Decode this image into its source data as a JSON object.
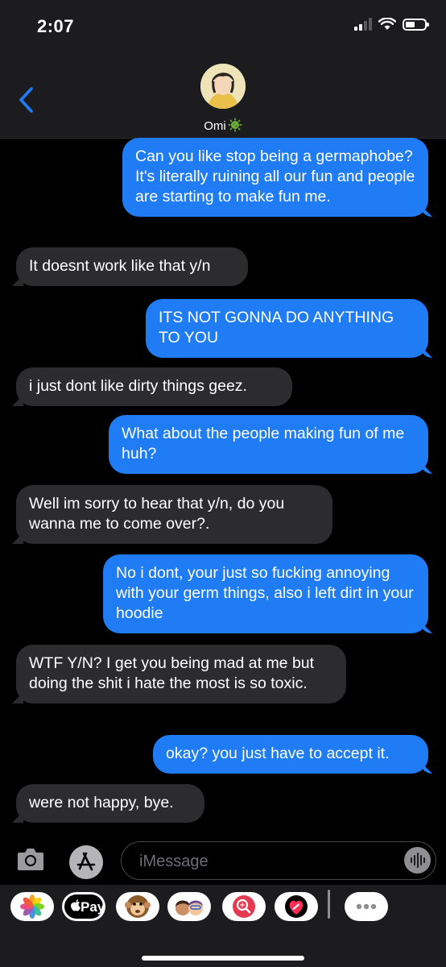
{
  "status_bar": {
    "time": "2:07"
  },
  "header": {
    "contact_name": "Omi",
    "contact_emoji_icon": "microbe-emoji-icon"
  },
  "messages": [
    {
      "direction": "out",
      "text": "Can you like stop being a germaphobe? It's literally ruining all our fun and people are starting to make fun me."
    },
    {
      "direction": "in",
      "text": "It doesnt work like that y/n"
    },
    {
      "direction": "out",
      "text": "ITS NOT GONNA DO ANYTHING TO YOU"
    },
    {
      "direction": "in",
      "text": "i just dont like dirty things geez."
    },
    {
      "direction": "out",
      "text": "What about the people making fun of me huh?"
    },
    {
      "direction": "in",
      "text": "Well im sorry to hear that y/n, do you wanna me to come over?."
    },
    {
      "direction": "out",
      "text": "No i dont, your just so fucking annoying with your germ things, also i left dirt in your hoodie"
    },
    {
      "direction": "in",
      "text": "WTF Y/N? I get you being mad at me but doing the shit i hate the most is so toxic."
    },
    {
      "direction": "out",
      "text": "okay? you just have to accept it."
    },
    {
      "direction": "in",
      "text": "were not happy, bye."
    }
  ],
  "input": {
    "placeholder": "iMessage",
    "value": ""
  },
  "app_drawer": {
    "apps": [
      "photos-icon",
      "apple-pay-icon",
      "animoji-icon",
      "memoji-icon",
      "image-search-icon",
      "digital-touch-icon",
      "more-icon"
    ],
    "pay_label": "Pay"
  },
  "colors": {
    "sent_bubble": "#1f7cf5",
    "received_bubble": "#2c2c2e",
    "background": "#000000",
    "accent": "#1f7cf5"
  }
}
